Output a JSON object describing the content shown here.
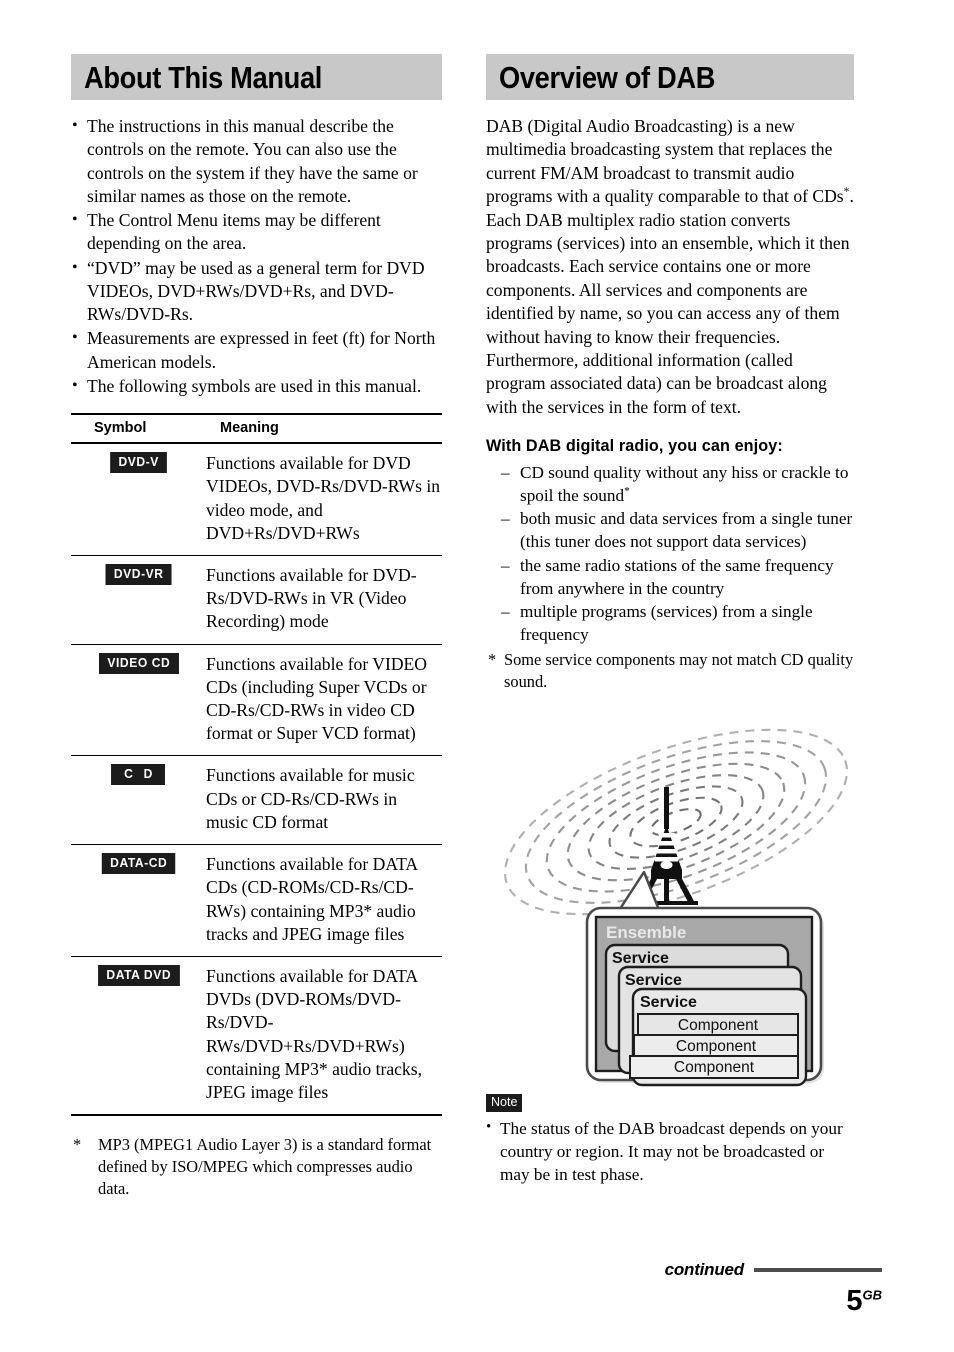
{
  "left_column": {
    "heading": "About This Manual",
    "bullets": [
      "The instructions in this manual describe the controls on the remote. You can also use the controls on the system if they have the same or similar names as those on the remote.",
      "The Control Menu items may be different depending on the area.",
      "“DVD” may be used as a general term for DVD VIDEOs, DVD+RWs/DVD+Rs, and DVD-RWs/DVD-Rs.",
      "Measurements are expressed in feet (ft) for North American models.",
      "The following symbols are used in this manual."
    ],
    "table": {
      "headers": [
        "Symbol",
        "Meaning"
      ],
      "rows": [
        {
          "symbol": "DVD-V",
          "meaning": "Functions available for DVD VIDEOs, DVD-Rs/DVD-RWs in video mode, and DVD+Rs/DVD+RWs"
        },
        {
          "symbol": "DVD-VR",
          "meaning": "Functions available for DVD-Rs/DVD-RWs in VR (Video Recording) mode"
        },
        {
          "symbol": "VIDEO CD",
          "meaning": "Functions available for VIDEO CDs (including Super VCDs or CD-Rs/CD-RWs in video CD format or Super VCD format)"
        },
        {
          "symbol": "C D",
          "meaning": "Functions available for music CDs or CD-Rs/CD-RWs in music CD format"
        },
        {
          "symbol": "DATA-CD",
          "meaning": "Functions available for DATA CDs (CD-ROMs/CD-Rs/CD-RWs) containing MP3* audio tracks and JPEG image files"
        },
        {
          "symbol": "DATA DVD",
          "meaning": "Functions available for DATA DVDs (DVD-ROMs/DVD-Rs/DVD-RWs/DVD+Rs/DVD+RWs) containing MP3* audio tracks, JPEG image files"
        }
      ]
    },
    "footnote": {
      "mark": "*",
      "text": "MP3 (MPEG1 Audio Layer 3) is a standard format defined by ISO/MPEG which compresses audio data."
    }
  },
  "right_column": {
    "heading": "Overview of DAB",
    "paragraph1_before_sup": "DAB (Digital Audio Broadcasting) is a new multimedia broadcasting system that replaces the current FM/AM broadcast to transmit audio programs with a quality comparable to that of CDs",
    "paragraph1_sup": "*",
    "paragraph1_after_sup": ".",
    "paragraph2": "Each DAB multiplex radio station converts programs (services) into an ensemble, which it then broadcasts. Each service contains one or more components. All services and components are identified by name, so you can access any of them without having to know their frequencies. Furthermore, additional information (called program associated data) can be broadcast along with the services in the form of text.",
    "sub_heading": "With DAB digital radio, you can enjoy:",
    "benefits": [
      {
        "text": "CD sound quality without any hiss or crackle to spoil the sound",
        "sup": "*"
      },
      {
        "text": "both music and data services from a single tuner (this tuner does not support data services)",
        "sup": ""
      },
      {
        "text": "the same radio stations of the same frequency from anywhere in the country",
        "sup": ""
      },
      {
        "text": "multiple programs (services) from a single frequency",
        "sup": ""
      }
    ],
    "footnote": {
      "mark": "*",
      "text": "Some service components may not match CD quality sound."
    },
    "diagram": {
      "ensemble_label": "Ensemble",
      "service_labels": [
        "Service",
        "Service",
        "Service"
      ],
      "component_labels": [
        "Component",
        "Component",
        "Component"
      ],
      "tower_icon": "broadcast-tower-icon",
      "ensemble_fill": "#a8a8a8",
      "service_fill": "#dcdcdc",
      "component_fill": "#eaeaea",
      "wave_color": "#9a9a9a"
    },
    "note": {
      "label": "Note",
      "items": [
        "The status of the DAB broadcast depends on your country or region. It may not be broadcasted or may be in test phase."
      ]
    }
  },
  "footer": {
    "continued": "continued",
    "page_number": "5",
    "page_region": "GB"
  }
}
